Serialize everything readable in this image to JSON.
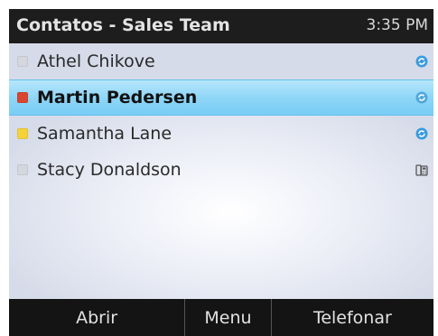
{
  "header": {
    "title": "Contatos - Sales Team",
    "time": "3:35 PM"
  },
  "contacts": [
    {
      "name": "Athel Chikove",
      "presence_color": "#d4d8de",
      "status_icon": "sync-icon",
      "selected": false
    },
    {
      "name": "Martin Pedersen",
      "presence_color": "#d9452f",
      "status_icon": "sync-icon",
      "selected": true
    },
    {
      "name": "Samantha Lane",
      "presence_color": "#f6d23a",
      "status_icon": "sync-icon",
      "selected": false
    },
    {
      "name": "Stacy Donaldson",
      "presence_color": "#d4d8de",
      "status_icon": "desk-phone-icon",
      "selected": false
    }
  ],
  "softkeys": {
    "left": "Abrir",
    "middle": "Menu",
    "right": "Telefonar"
  },
  "colors": {
    "selection": "#8fd6f7",
    "title_bar": "#1d1d1d",
    "sync_icon": "#3a9be0"
  }
}
